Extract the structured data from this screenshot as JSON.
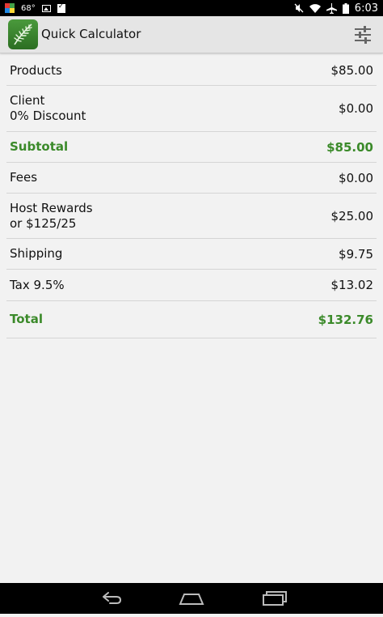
{
  "status_bar": {
    "temperature": "68°",
    "time": "6:03"
  },
  "app": {
    "title": "Quick Calculator",
    "accent_color": "#3b8a2a"
  },
  "rows": [
    {
      "label": "Products",
      "value": "$85.00"
    },
    {
      "label": "Client",
      "sublabel": "0% Discount",
      "value": "$0.00"
    },
    {
      "label": "Subtotal",
      "value": "$85.00"
    },
    {
      "label": "Fees",
      "value": "$0.00"
    },
    {
      "label": "Host Rewards",
      "sublabel": "or $125/25",
      "value": "$25.00"
    },
    {
      "label": "Shipping",
      "value": "$9.75"
    },
    {
      "label": "Tax 9.5%",
      "value": "$13.02"
    },
    {
      "label": "Total",
      "value": "$132.76"
    }
  ],
  "icons": {
    "settings": "sliders-icon",
    "back": "back-icon",
    "home": "home-icon",
    "recents": "recents-icon"
  }
}
